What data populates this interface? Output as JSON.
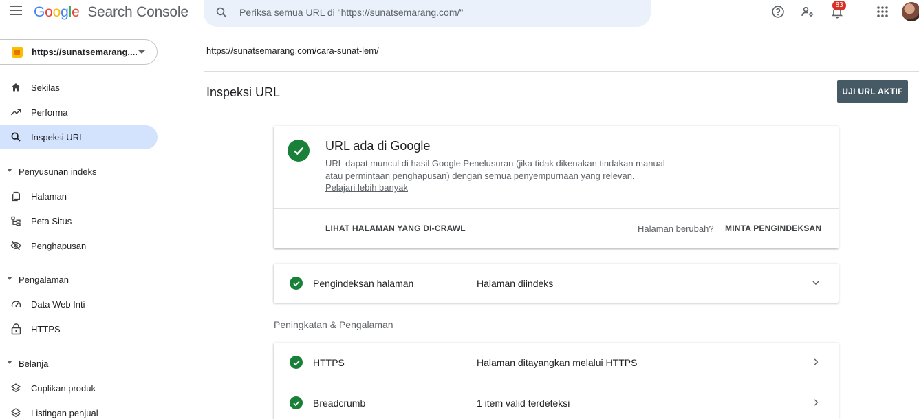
{
  "header": {
    "logo_google": [
      "G",
      "o",
      "o",
      "g",
      "l",
      "e"
    ],
    "logo_product": "Search Console",
    "search_placeholder": "Periksa semua URL di \"https://sunatsemarang.com/\"",
    "notification_count": "83"
  },
  "sidebar": {
    "property_label": "https://sunatsemarang....",
    "items_top": [
      {
        "label": "Sekilas",
        "icon": "home-icon"
      },
      {
        "label": "Performa",
        "icon": "trending-up-icon"
      },
      {
        "label": "Inspeksi URL",
        "icon": "search-icon",
        "active": true
      }
    ],
    "sections": [
      {
        "label": "Penyusunan indeks",
        "items": [
          {
            "label": "Halaman",
            "icon": "pages-icon"
          },
          {
            "label": "Peta Situs",
            "icon": "sitemap-icon"
          },
          {
            "label": "Penghapusan",
            "icon": "visibility-off-icon"
          }
        ]
      },
      {
        "label": "Pengalaman",
        "items": [
          {
            "label": "Data Web Inti",
            "icon": "speed-gauge-icon"
          },
          {
            "label": "HTTPS",
            "icon": "lock-icon"
          }
        ]
      },
      {
        "label": "Belanja",
        "items": [
          {
            "label": "Cuplikan produk",
            "icon": "layers-icon"
          },
          {
            "label": "Listingan penjual",
            "icon": "layers-icon"
          }
        ]
      }
    ]
  },
  "main": {
    "url_path": "https://sunatsemarang.com/cara-sunat-lem/",
    "page_title": "Inspeksi URL",
    "test_live_button": "UJI URL AKTIF",
    "status_card": {
      "title": "URL ada di Google",
      "description": "URL dapat muncul di hasil Google Penelusuran (jika tidak dikenakan tindakan manual atau permintaan penghapusan) dengan semua penyempurnaan yang relevan.",
      "learn_more": "Pelajari lebih banyak",
      "view_crawled": "LIHAT HALAMAN YANG DI-CRAWL",
      "page_changed": "Halaman berubah?",
      "request_indexing": "MINTA PENGINDEKSAN"
    },
    "indexing_row": {
      "name": "Pengindeksan halaman",
      "value": "Halaman diindeks"
    },
    "enhancements_label": "Peningkatan & Pengalaman",
    "enhancements": [
      {
        "name": "HTTPS",
        "value": "Halaman ditayangkan melalui HTTPS"
      },
      {
        "name": "Breadcrumb",
        "value": "1 item valid terdeteksi"
      }
    ]
  },
  "colors": {
    "accent_green": "#188038",
    "active_nav": "#d3e3fd",
    "button": "#455a64",
    "search_bg": "#eaf1fb"
  }
}
